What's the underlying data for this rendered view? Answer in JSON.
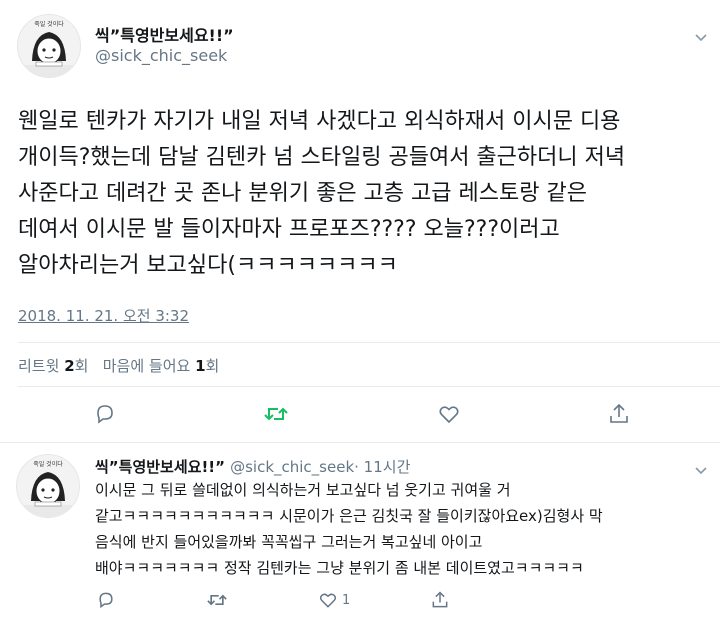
{
  "main_tweet": {
    "author_name": "씩”특영반보세요!!”",
    "handle": "@sick_chic_seek",
    "avatar_text": "죽일 것이다",
    "text": "웬일로 텐카가 자기가 내일 저녁 사겠다고 외식하재서 이시문 디용\n개이득?했는데 담날 김텐카 넘 스타일링 공들여서 출근하더니 저녁\n사준다고 데려간 곳 존나 분위기 좋은 고층 고급 레스토랑 같은\n데여서 이시문 발 들이자마자 프로포즈???? 오늘???이러고\n알아차리는거 보고싶다(ㅋㅋㅋㅋㅋㅋㅋㅋ",
    "timestamp": "2018. 11. 21. 오전 3:32",
    "retweets_label": "리트윗",
    "retweets_count": "2",
    "retweets_unit": "회",
    "likes_label": "마음에 들어요",
    "likes_count": "1",
    "likes_unit": "회"
  },
  "reply_tweet": {
    "author_name": "씩”특영반보세요!!”",
    "handle": "@sick_chic_seek",
    "time": "· 11시간",
    "avatar_text": "죽일 것이다",
    "text": "이시문 그 뒤로 쓸데없이 의식하는거 보고싶다 넘 웃기고 귀여울 거\n같고ㅋㅋㅋㅋㅋㅋㅋㅋㅋㅋㅋ 시문이가 은근 김칫국 잘 들이키잖아요ex)김형사 막\n음식에 반지 들어있을까봐 꼭꼭씹구 그러는거 복고싶네 아이고\n배야ㅋㅋㅋㅋㅋㅋㅋ 정작 김텐카는 그냥 분위기 좀 내본 데이트였고ㅋㅋㅋㅋㅋ",
    "like_count": "1"
  },
  "colors": {
    "retweet_green": "#17bf63",
    "icon_gray": "#657786",
    "divider": "#e6ecf0"
  },
  "icons": [
    "reply-icon",
    "retweet-icon",
    "like-icon",
    "share-icon",
    "chevron-down-icon"
  ]
}
